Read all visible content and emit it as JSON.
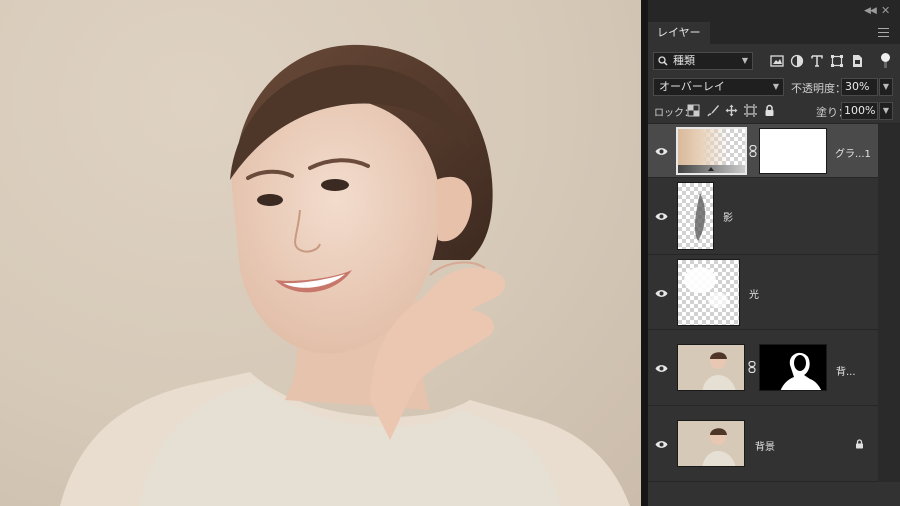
{
  "panel": {
    "tab_label": "レイヤー",
    "filter_label": "種類",
    "blend_mode": "オーバーレイ",
    "opacity_label": "不透明度：",
    "opacity_value": "30%",
    "lock_label": "ロック：",
    "fill_label": "塗り：",
    "fill_value": "100%"
  },
  "filter_icons": [
    "image-filter-icon",
    "adjustment-filter-icon",
    "type-filter-icon",
    "shape-filter-icon",
    "smart-object-filter-icon"
  ],
  "lock_icons": [
    "lock-transparent-pixels-icon",
    "lock-image-pixels-icon",
    "lock-position-icon",
    "lock-artboard-icon",
    "lock-all-icon"
  ],
  "layers": [
    {
      "name": "グラ...1",
      "type": "gradient-map-adjustment",
      "visible": true,
      "selected": true
    },
    {
      "name": "影",
      "type": "pixel",
      "visible": true,
      "selected": false
    },
    {
      "name": "光",
      "type": "pixel",
      "visible": true,
      "selected": false
    },
    {
      "name": "背...",
      "type": "pixel-with-mask",
      "visible": true,
      "selected": false
    },
    {
      "name": "背景",
      "type": "background",
      "visible": true,
      "locked": true,
      "selected": false
    }
  ],
  "colors": {
    "panel_bg": "#323232",
    "panel_dark": "#262626",
    "selected_row": "#4a4a4a",
    "canvas_bg": "#d6c9b8"
  }
}
